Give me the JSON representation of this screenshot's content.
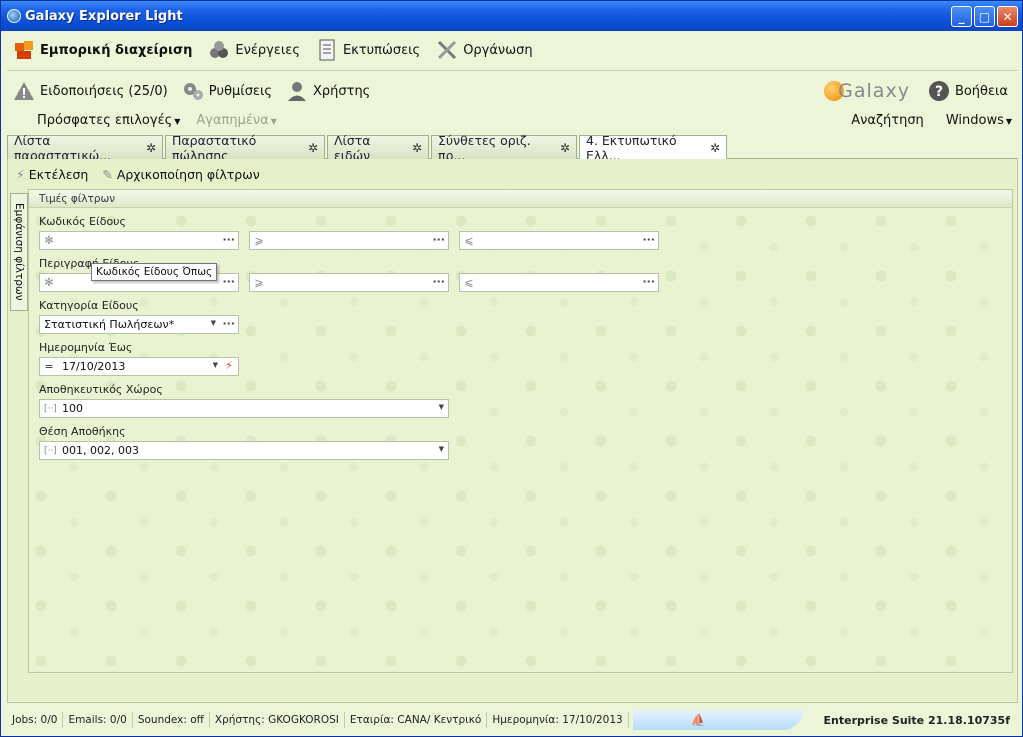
{
  "window": {
    "title": "Galaxy Explorer Light"
  },
  "menu1": [
    {
      "label": "Εμπορική διαχείριση",
      "icon": "commerce-icon"
    },
    {
      "label": "Ενέργειες",
      "icon": "actions-icon"
    },
    {
      "label": "Εκτυπώσεις",
      "icon": "print-icon"
    },
    {
      "label": "Οργάνωση",
      "icon": "tools-icon"
    }
  ],
  "menu2": {
    "notifications": "Ειδοποιήσεις (25/0)",
    "settings": "Ρυθμίσεις",
    "user": "Χρήστης",
    "logo": "Galaxy",
    "help": "Βοήθεια"
  },
  "menu3": {
    "recent": "Πρόσφατες επιλογές",
    "favorites": "Αγαπημένα",
    "search": "Αναζήτηση",
    "windows": "Windows"
  },
  "tabs": [
    {
      "label": "Λίστα παραστατικώ...",
      "active": false
    },
    {
      "label": "Παραστατικό πώλησης",
      "active": false
    },
    {
      "label": "Λίστα ειδών",
      "active": false
    },
    {
      "label": "Σύνθετες οριζ. πρ...",
      "active": false
    },
    {
      "label": "4. Εκτυπωτικό Ελλ...",
      "active": true
    }
  ],
  "toolbar": {
    "execute": "Εκτέλεση",
    "reset": "Αρχικοποίηση φίλτρων"
  },
  "side_tab": "Εμφάνιση φίλτρων",
  "panel": {
    "header": "Τιμές φίλτρων",
    "fields": {
      "item_code": {
        "label": "Κωδικός Είδους",
        "op1": "✻",
        "op2": "⩾",
        "op3": "⩽"
      },
      "item_desc": {
        "label": "Περιγραφή Είδους",
        "op1": "✻",
        "op2": "⩾",
        "op3": "⩽"
      },
      "category": {
        "label": "Κατηγορία Είδους",
        "value": "Στατιστική Πωλήσεων*"
      },
      "date_to": {
        "label": "Ημερομηνία Έως",
        "op": "=",
        "value": "17/10/2013"
      },
      "warehouse": {
        "label": "Αποθηκευτικός Χώρος",
        "value": "100"
      },
      "location": {
        "label": "Θέση Αποθήκης",
        "value": "001, 002, 003"
      }
    },
    "tooltip": "Κωδικός Είδους Όπως"
  },
  "status": {
    "jobs": "Jobs: 0/0",
    "emails": "Emails: 0/0",
    "soundex": "Soundex: off",
    "user": "Χρήστης: GKOGKOROSI",
    "company": "Εταιρία: CANA/ Κεντρικό",
    "date": "Ημερομηνία: 17/10/2013",
    "suite": "Enterprise Suite  21.18.10735f"
  }
}
